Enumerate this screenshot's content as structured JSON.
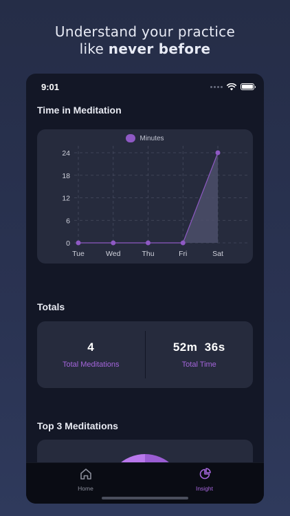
{
  "headline": {
    "line1": "Understand your practice",
    "line2_prefix": "like ",
    "line2_bold": "never before"
  },
  "status_bar": {
    "time": "9:01",
    "icons": [
      "signal-dots-icon",
      "wifi-icon",
      "battery-icon"
    ]
  },
  "time_in_meditation": {
    "title": "Time in Meditation",
    "legend": "Minutes"
  },
  "chart_data": {
    "type": "area",
    "categories": [
      "Tue",
      "Wed",
      "Thu",
      "Fri",
      "Sat"
    ],
    "series": [
      {
        "name": "Minutes",
        "values": [
          0,
          0,
          0,
          0,
          24
        ]
      }
    ],
    "yticks": [
      0,
      6,
      12,
      18,
      24
    ],
    "ylim": [
      0,
      24
    ],
    "grid": true,
    "legend_position": "top-center",
    "colors": {
      "line": "#8e59c4",
      "fill": "#4c4f6a"
    }
  },
  "totals": {
    "title": "Totals",
    "items": [
      {
        "value": "4",
        "label": "Total Meditations"
      },
      {
        "value": "52m  36s",
        "label": "Total Time"
      }
    ]
  },
  "top3": {
    "title": "Top 3 Meditations"
  },
  "tab_bar": {
    "tabs": [
      {
        "label": "Home",
        "icon": "home-icon",
        "active": false
      },
      {
        "label": "Insight",
        "icon": "pie-chart-icon",
        "active": true
      }
    ]
  },
  "colors": {
    "accent": "#a566dc",
    "background": "#131726",
    "card": "#262b3d"
  }
}
